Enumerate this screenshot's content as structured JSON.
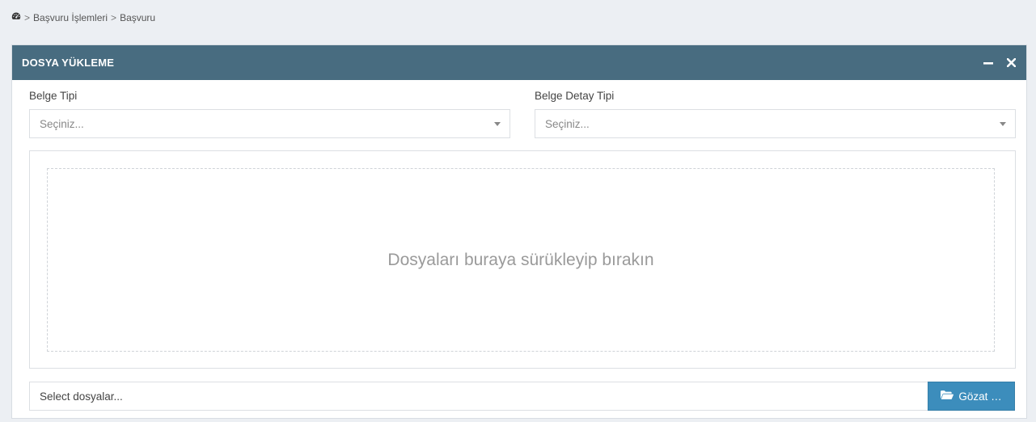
{
  "breadcrumb": {
    "icon": "dashboard-icon",
    "separator": ">",
    "items": [
      "Başvuru İşlemleri",
      "Başvuru"
    ]
  },
  "panel": {
    "title": "DOSYA YÜKLEME",
    "minimize_icon": "minus-icon",
    "close_icon": "times-icon",
    "header_color": "#486c80"
  },
  "form": {
    "belge_tipi": {
      "label": "Belge Tipi",
      "placeholder": "Seçiniz..."
    },
    "belge_detay_tipi": {
      "label": "Belge Detay Tipi",
      "placeholder": "Seçiniz..."
    }
  },
  "dropzone": {
    "text": "Dosyaları buraya sürükleyip bırakın"
  },
  "file_input": {
    "placeholder": "Select dosyalar...",
    "browse_label": "Gözat …",
    "browse_icon": "folder-open-icon",
    "button_color": "#3c8dbc"
  }
}
